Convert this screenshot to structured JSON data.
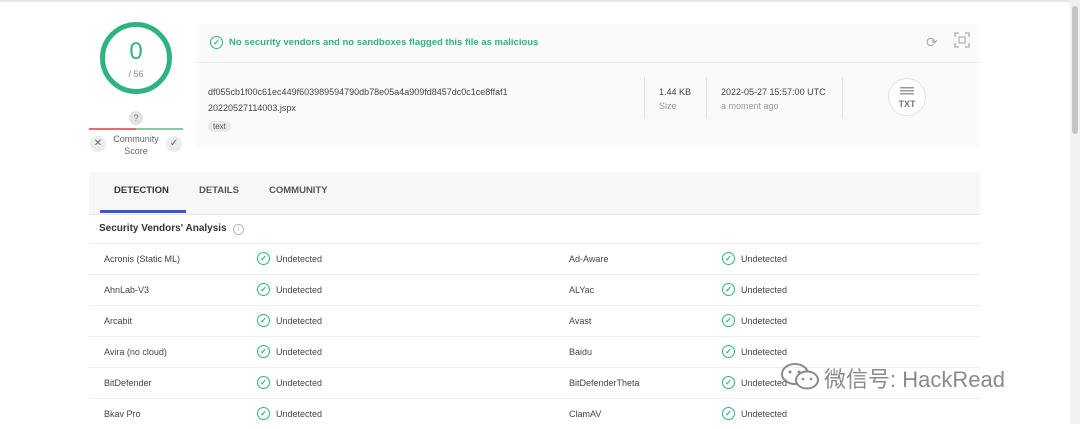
{
  "score": {
    "detections": "0",
    "total": "/ 56"
  },
  "community": {
    "question": "?",
    "label_line1": "Community",
    "label_line2": "Score",
    "dislike_icon": "close-icon",
    "like_icon": "check-icon"
  },
  "banner": {
    "text": "No security vendors and no sandboxes flagged this file as malicious"
  },
  "file": {
    "hash": "df055cb1f00c61ec449f603989594790db78e05a4a909fd8457dc0c1ce8ffaf1",
    "name": "20220527114003.jspx",
    "tag": "text",
    "size_value": "1.44 KB",
    "size_label": "Size",
    "date_value": "2022-05-27 15:57:00 UTC",
    "date_label": "a moment ago",
    "type": "TXT"
  },
  "tabs": [
    {
      "label": "DETECTION",
      "active": true
    },
    {
      "label": "DETAILS",
      "active": false
    },
    {
      "label": "COMMUNITY",
      "active": false
    }
  ],
  "analysis": {
    "title": "Security Vendors' Analysis",
    "rows": [
      {
        "left_vendor": "Acronis (Static ML)",
        "left_status": "Undetected",
        "right_vendor": "Ad-Aware",
        "right_status": "Undetected"
      },
      {
        "left_vendor": "AhnLab-V3",
        "left_status": "Undetected",
        "right_vendor": "ALYac",
        "right_status": "Undetected"
      },
      {
        "left_vendor": "Arcabit",
        "left_status": "Undetected",
        "right_vendor": "Avast",
        "right_status": "Undetected"
      },
      {
        "left_vendor": "Avira (no cloud)",
        "left_status": "Undetected",
        "right_vendor": "Baidu",
        "right_status": "Undetected"
      },
      {
        "left_vendor": "BitDefender",
        "left_status": "Undetected",
        "right_vendor": "BitDefenderTheta",
        "right_status": "Undetected"
      },
      {
        "left_vendor": "Bkav Pro",
        "left_status": "Undetected",
        "right_vendor": "ClamAV",
        "right_status": "Undetected"
      }
    ]
  },
  "watermark": {
    "text": "微信号: HackRead"
  },
  "colors": {
    "accent_green": "#2eb47f",
    "tab_underline": "#3c58c8"
  }
}
